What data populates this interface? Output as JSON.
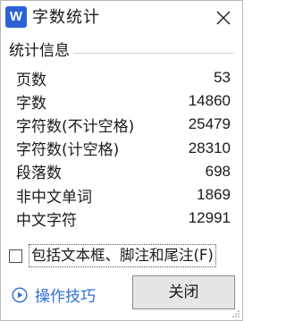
{
  "window": {
    "app_icon_letter": "W",
    "title": "字数统计"
  },
  "group": {
    "title": "统计信息"
  },
  "stats": [
    {
      "label": "页数",
      "value": "53"
    },
    {
      "label": "字数",
      "value": "14860"
    },
    {
      "label": "字符数(不计空格)",
      "value": "25479"
    },
    {
      "label": "字符数(计空格)",
      "value": "28310"
    },
    {
      "label": "段落数",
      "value": "698"
    },
    {
      "label": "非中文单词",
      "value": "1869"
    },
    {
      "label": "中文字符",
      "value": "12991"
    }
  ],
  "options": {
    "include_textboxes_label": "包括文本框、脚注和尾注(F)",
    "include_textboxes_checked": false
  },
  "footer": {
    "tips_label": "操作技巧",
    "close_label": "关闭"
  },
  "colors": {
    "app_icon": "#2d62d6",
    "link": "#2f6fd6",
    "button_bg": "#e6e6e6"
  },
  "icons": {
    "app": "wps-writer-icon",
    "close": "close-icon",
    "tips": "play-circle-icon"
  }
}
